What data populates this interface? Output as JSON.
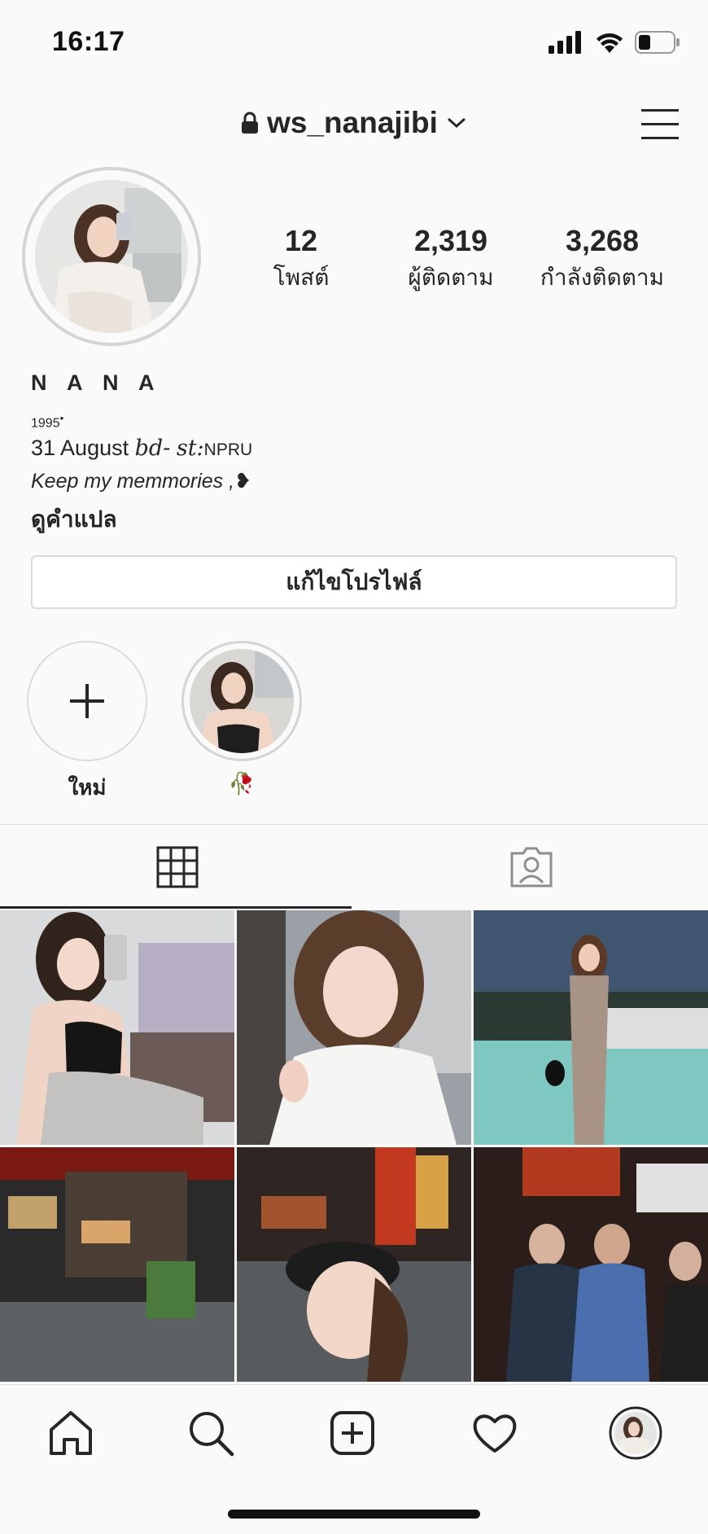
{
  "status": {
    "time": "16:17"
  },
  "header": {
    "username": "ws_nanajibi"
  },
  "stats": [
    {
      "value": "12",
      "label": "โพสต์"
    },
    {
      "value": "2,319",
      "label": "ผู้ติดตาม"
    },
    {
      "value": "3,268",
      "label": "กำลังติดตาม"
    }
  ],
  "bio": {
    "name": "N A N A",
    "year": "1995",
    "date": "31 August",
    "bd": "bd-",
    "st": "st:",
    "school": "NPRU",
    "tagline": "Keep my memmories ,❥",
    "translate": "ดูคำแปล"
  },
  "edit_profile_label": "แก้ไขโปรไฟล์",
  "highlights": [
    {
      "label": "ใหม่",
      "icon": "plus-icon"
    },
    {
      "label": "🥀",
      "icon": "story-thumbnail"
    }
  ],
  "tabs": [
    {
      "name": "grid",
      "icon": "grid-icon",
      "active": true
    },
    {
      "name": "tagged",
      "icon": "tagged-person-icon",
      "active": false
    }
  ],
  "nav": [
    {
      "icon": "home-icon"
    },
    {
      "icon": "search-icon"
    },
    {
      "icon": "add-post-icon"
    },
    {
      "icon": "heart-icon"
    },
    {
      "icon": "profile-avatar"
    }
  ],
  "colors": {
    "text": "#262626",
    "border": "#dbdbdb",
    "background": "#fafafa"
  }
}
